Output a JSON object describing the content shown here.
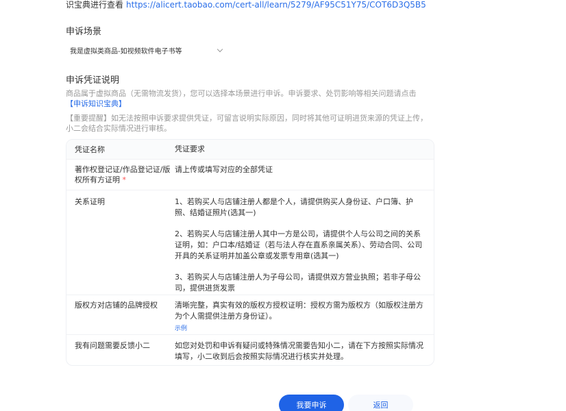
{
  "top": {
    "prefix": "识宝典进行查看",
    "link": "https://alicert.taobao.com/cert-all/learn/5279/AF95C51Y75/COT6D3Q5B5"
  },
  "scene": {
    "title": "申诉场景",
    "selected": "我是虚拟类商品-如视频软件电子书等"
  },
  "desc": {
    "title": "申诉凭证说明",
    "line1": "商品属于虚拟商品（无需物流发货），您可以选择本场景进行申诉。申诉要求、处罚影响等相关问题请点击",
    "link": "【申诉知识宝典】",
    "line2": "【重要提醒】如无法按照申诉要求提供凭证，可留言说明实际原因，同时将其他可证明进货来源的凭证上传，小二会结合实际情况进行审核。"
  },
  "table": {
    "head": {
      "name": "凭证名称",
      "req": "凭证要求"
    },
    "rows": [
      {
        "name": "著作权登记证/作品登记证/版权所有方证明",
        "star": "*",
        "req": "请上传或填写对应的全部凭证"
      },
      {
        "name": "关系证明",
        "p1": "1、若购买人与店铺注册人都是个人，请提供购买人身份证、户口簿、护照、结婚证照片(选其一)",
        "p2": "2、若购买人与店铺注册人其中一方是公司，请提供个人与公司之间的关系证明，如：户口本/结婚证（若与法人存在直系亲属关系）、劳动合同、公司开具的关系证明并加盖公章或发票专用章(选其一)",
        "p3": "3、若购买人与店铺注册人为子母公司，请提供双方营业执照；若非子母公司，提供进货发票"
      },
      {
        "name": "版权方对店铺的品牌授权",
        "req": "清晰完整，真实有效的版权方授权证明：授权方需为版权方（如版权注册方为个人需提供注册方身份证）。",
        "example": "示例"
      },
      {
        "name": "我有问题需要反馈小二",
        "req": "如您对处罚和申诉有疑问或特殊情况需要告知小二，请在下方按照实际情况填写，小二收到后会按照实际情况进行核实并处理。"
      }
    ]
  },
  "buttons": {
    "submit": "我要申诉",
    "back": "返回"
  }
}
